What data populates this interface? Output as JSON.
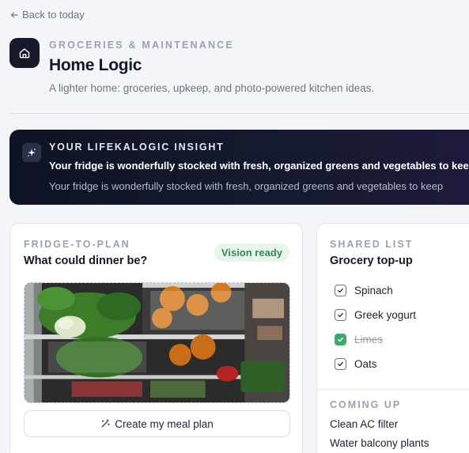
{
  "nav": {
    "back_label": "Back to today"
  },
  "header": {
    "icon": "home-icon",
    "eyebrow": "GROCERIES & MAINTENANCE",
    "title": "Home Logic",
    "subtitle": "A lighter home: groceries, upkeep, and photo-powered kitchen ideas."
  },
  "insight": {
    "icon": "sparkle-icon",
    "label": "YOUR LIFEKALOGIC INSIGHT",
    "headline": "Your fridge is wonderfully stocked with fresh, organized greens and vegetables to keep",
    "body": "Your fridge is wonderfully stocked with fresh, organized greens and vegetables to keep"
  },
  "fridge": {
    "eyebrow": "FRIDGE-TO-PLAN",
    "title": "What could dinner be?",
    "badge": "Vision ready",
    "action_label": "Create my meal plan",
    "action_icon": "magic-wand-icon"
  },
  "shared_list": {
    "eyebrow": "SHARED LIST",
    "title": "Grocery top-up",
    "items": [
      {
        "label": "Spinach",
        "done": false
      },
      {
        "label": "Greek yogurt",
        "done": false
      },
      {
        "label": "Limes",
        "done": true
      },
      {
        "label": "Oats",
        "done": false
      }
    ],
    "upcoming_title": "COMING UP",
    "upcoming": [
      "Clean AC filter",
      "Water balcony plants"
    ]
  },
  "colors": {
    "background": "#f4f5f9",
    "insight_bg": "#0f1424",
    "badge_bg": "#e7f5ec",
    "badge_text": "#2f8a53",
    "check_green": "#3aab6b"
  }
}
